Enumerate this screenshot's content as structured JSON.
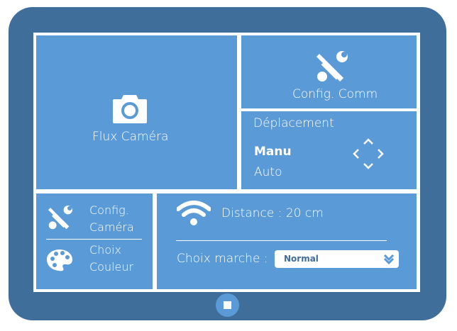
{
  "colors": {
    "frame": "#3f6e9b",
    "tile": "#5a9ad6",
    "background": "#ffffff"
  },
  "camera_tile": {
    "label": "Flux Caméra",
    "icon": "camera-icon"
  },
  "comm_tile": {
    "label": "Config. Comm",
    "icon": "tools-icon"
  },
  "movement_tile": {
    "title": "Déplacement",
    "modes": [
      "Manu",
      "Auto"
    ],
    "selected_mode": "Manu",
    "icon": "direction-arrows-icon"
  },
  "config_tile": {
    "camera_label_line1": "Config.",
    "camera_label_line2": "Caméra",
    "camera_icon": "tools-icon",
    "color_label_line1": "Choix",
    "color_label_line2": "Couleur",
    "color_icon": "palette-icon"
  },
  "status_tile": {
    "distance_label": "Distance : 20 cm",
    "signal_icon": "wifi-icon",
    "mode_label": "Choix marche :",
    "mode_value": "Normal"
  },
  "home_button": {
    "icon": "stop-square-icon"
  }
}
